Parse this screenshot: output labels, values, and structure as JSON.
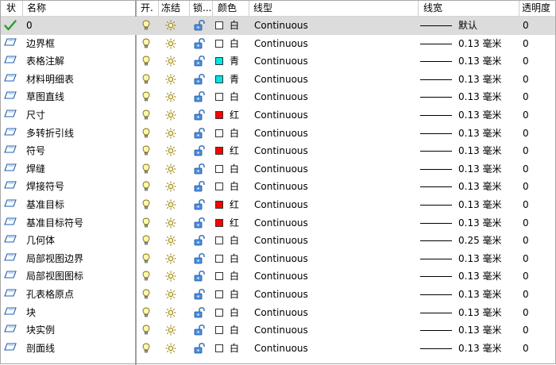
{
  "header": {
    "status": "状",
    "name": "名称",
    "on": "开.",
    "freeze": "冻结",
    "lock": "锁...",
    "color": "颜色",
    "linetype": "线型",
    "lineweight": "线宽",
    "transparency": "透明度"
  },
  "colors": {
    "white": "#ffffff",
    "cyan": "#00e5e5",
    "red": "#ff0000"
  },
  "layers": [
    {
      "name": "0",
      "current": true,
      "color_name": "白",
      "color": "white",
      "linetype": "Continuous",
      "lineweight": "默认",
      "transparency": "0"
    },
    {
      "name": "边界框",
      "color_name": "白",
      "color": "white",
      "linetype": "Continuous",
      "lineweight": "0.13 毫米",
      "transparency": "0"
    },
    {
      "name": "表格注解",
      "color_name": "青",
      "color": "cyan",
      "linetype": "Continuous",
      "lineweight": "0.13 毫米",
      "transparency": "0"
    },
    {
      "name": "材料明细表",
      "color_name": "青",
      "color": "cyan",
      "linetype": "Continuous",
      "lineweight": "0.13 毫米",
      "transparency": "0"
    },
    {
      "name": "草图直线",
      "color_name": "白",
      "color": "white",
      "linetype": "Continuous",
      "lineweight": "0.13 毫米",
      "transparency": "0"
    },
    {
      "name": "尺寸",
      "color_name": "红",
      "color": "red",
      "linetype": "Continuous",
      "lineweight": "0.13 毫米",
      "transparency": "0"
    },
    {
      "name": "多转折引线",
      "color_name": "白",
      "color": "white",
      "linetype": "Continuous",
      "lineweight": "0.13 毫米",
      "transparency": "0"
    },
    {
      "name": "符号",
      "color_name": "红",
      "color": "red",
      "linetype": "Continuous",
      "lineweight": "0.13 毫米",
      "transparency": "0"
    },
    {
      "name": "焊缝",
      "color_name": "白",
      "color": "white",
      "linetype": "Continuous",
      "lineweight": "0.13 毫米",
      "transparency": "0"
    },
    {
      "name": "焊接符号",
      "color_name": "白",
      "color": "white",
      "linetype": "Continuous",
      "lineweight": "0.13 毫米",
      "transparency": "0"
    },
    {
      "name": "基准目标",
      "color_name": "红",
      "color": "red",
      "linetype": "Continuous",
      "lineweight": "0.13 毫米",
      "transparency": "0"
    },
    {
      "name": "基准目标符号",
      "color_name": "红",
      "color": "red",
      "linetype": "Continuous",
      "lineweight": "0.13 毫米",
      "transparency": "0"
    },
    {
      "name": "几何体",
      "color_name": "白",
      "color": "white",
      "linetype": "Continuous",
      "lineweight": "0.25 毫米",
      "transparency": "0"
    },
    {
      "name": "局部视图边界",
      "color_name": "白",
      "color": "white",
      "linetype": "Continuous",
      "lineweight": "0.13 毫米",
      "transparency": "0"
    },
    {
      "name": "局部视图图标",
      "color_name": "白",
      "color": "white",
      "linetype": "Continuous",
      "lineweight": "0.13 毫米",
      "transparency": "0"
    },
    {
      "name": "孔表格原点",
      "color_name": "白",
      "color": "white",
      "linetype": "Continuous",
      "lineweight": "0.13 毫米",
      "transparency": "0"
    },
    {
      "name": "块",
      "color_name": "白",
      "color": "white",
      "linetype": "Continuous",
      "lineweight": "0.13 毫米",
      "transparency": "0"
    },
    {
      "name": "块实例",
      "color_name": "白",
      "color": "white",
      "linetype": "Continuous",
      "lineweight": "0.13 毫米",
      "transparency": "0"
    },
    {
      "name": "剖面线",
      "color_name": "白",
      "color": "white",
      "linetype": "Continuous",
      "lineweight": "0.13 毫米",
      "transparency": "0"
    }
  ]
}
